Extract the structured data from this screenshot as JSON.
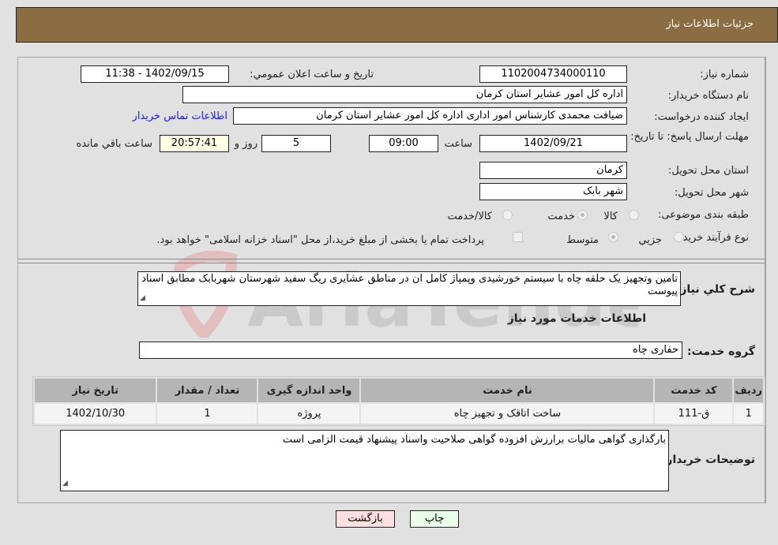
{
  "header": {
    "title": "جزئیات اطلاعات نیاز"
  },
  "fields": {
    "need_number_label": "شماره نیاز:",
    "need_number": "1102004734000110",
    "announce_label": "تاریخ و ساعت اعلان عمومي:",
    "announce_value": "1402/09/15 - 11:38",
    "buyer_org_label": "نام دستگاه خریدار:",
    "buyer_org": "اداره کل امور عشایر استان کرمان",
    "requester_label": "ایجاد کننده درخواست:",
    "requester": "ضیافت محمدی کارشناس امور اداری اداره کل امور عشایر استان کرمان",
    "buyer_contact_link": "اطلاعات تماس خریدار",
    "deadline_label": "مهلت ارسال پاسخ: تا تاریخ:",
    "deadline_date": "1402/09/21",
    "time_label": "ساعت",
    "deadline_time": "09:00",
    "days_value": "5",
    "days_label": "روز و",
    "remaining_time": "20:57:41",
    "remaining_label": "ساعت باقي مانده",
    "province_label": "استان محل تحویل:",
    "province": "کرمان",
    "city_label": "شهر محل تحویل:",
    "city": "شهر بابک",
    "category_label": "طبقه بندی موضوعی:",
    "category_options": [
      {
        "label": "کالا",
        "selected": false
      },
      {
        "label": "خدمت",
        "selected": true
      },
      {
        "label": "کالا/خدمت",
        "selected": false
      }
    ],
    "process_label": "نوع فرآیند خرید :",
    "process_options": [
      {
        "label": "جزيي",
        "selected": false
      },
      {
        "label": "متوسط",
        "selected": true
      }
    ],
    "treasury_checkbox_checked": false,
    "treasury_note": "پرداخت تمام یا بخشی از مبلغ خرید،از محل \"اسناد خزانه اسلامی\" خواهد بود."
  },
  "description": {
    "label": "شرح کلي نياز:",
    "text": "تامین وتجهیز یک حلقه چاه با سیستم خورشیدی وپمپاژ کامل ان در مناطق عشایری ریگ سفید شهرستان شهربابک مطابق اسناد پیوست"
  },
  "services": {
    "section_title": "اطلاعات خدمات مورد نیاز",
    "group_label": "گروه خدمت:",
    "group_value": "حفاری چاه",
    "columns": [
      "رديف",
      "کد خدمت",
      "نام خدمت",
      "واحد اندازه گیری",
      "تعداد / مقدار",
      "تاریخ نیاز"
    ],
    "rows": [
      [
        "1",
        "ق-111",
        "ساخت اتاقک و تجهیز چاه",
        "پروژه",
        "1",
        "1402/10/30"
      ]
    ]
  },
  "buyer_notes": {
    "label": "توضیحات خریدار:",
    "text": "بارگذاری گواهی مالیات برارزش افزوده گواهی صلاحیت واسناد پیشنهاد قیمت الزامی است"
  },
  "buttons": {
    "print": "چاپ",
    "back": "بازگشت"
  },
  "watermark": {
    "text": "AriaTender.neT"
  },
  "colors": {
    "header_bg": "#8b6d43",
    "print_bg": "#eaffea",
    "back_bg": "#ffe0e0",
    "link": "#1a1aff"
  }
}
